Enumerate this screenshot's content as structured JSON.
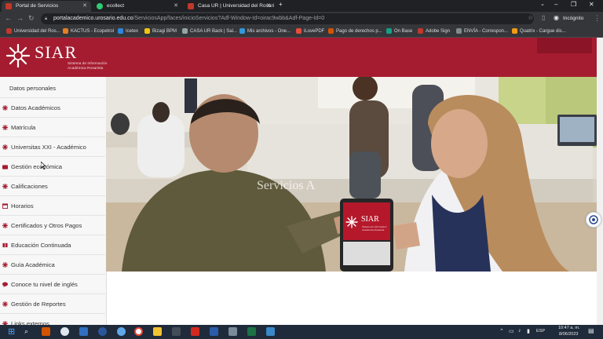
{
  "browser": {
    "tabs": [
      {
        "label": "Portal de Servicios",
        "active": true,
        "favicon_color": "#c0392b"
      },
      {
        "label": "ecollect",
        "active": false,
        "favicon_color": "#2ecc71"
      },
      {
        "label": "Casa UR | Universidad del Rosari",
        "active": false,
        "favicon_color": "#c0392b"
      }
    ],
    "new_tab": "+",
    "url_host": "portalacademico.urosario.edu.co",
    "url_path": "/ServiciosApp/faces/inicioServicios?Adf-Window-Id=oirac9wbb&Adf-Page-Id=0",
    "profile_label": "Incógnito",
    "bookmarks": [
      "Universidad del Ros...",
      "KACTUS - Ecopetrol",
      "Icetex",
      "Bizagi BPM",
      "CASA UR Back | Sal...",
      "Mis archivos - One...",
      "iLovePDF",
      "Pago de derechos p...",
      "On Base",
      "Adobe Sign",
      "ENVÍA - Correspon...",
      "Quatrix - Cargue dis..."
    ]
  },
  "header": {
    "brand": "SIAR",
    "subtitle_line1": "Sistema de Información",
    "subtitle_line2": "Académica Rosarista"
  },
  "sidebar": {
    "items": [
      {
        "label": "Datos personales",
        "icon": "none"
      },
      {
        "label": "Datos Académicos",
        "icon": "rosette-icon"
      },
      {
        "label": "Matrícula",
        "icon": "rosette-icon"
      },
      {
        "label": "Universitas XXI - Académico",
        "icon": "rosette-icon"
      },
      {
        "label": "Gestión económica",
        "icon": "wallet-icon"
      },
      {
        "label": "Calificaciones",
        "icon": "rosette-icon"
      },
      {
        "label": "Horarios",
        "icon": "calendar-icon"
      },
      {
        "label": "Certificados y Otros Pagos",
        "icon": "rosette-icon"
      },
      {
        "label": "Educación Continuada",
        "icon": "book-icon"
      },
      {
        "label": "Guía Académica",
        "icon": "rosette-icon"
      },
      {
        "label": "Conoce tu nivel de inglés",
        "icon": "chat-icon"
      },
      {
        "label": "Gestión de Reportes",
        "icon": "rosette-icon"
      },
      {
        "label": "Links externos",
        "icon": "rosette-icon"
      }
    ]
  },
  "hero": {
    "wall_text": "Servicios A",
    "tablet_brand": "SIAR",
    "tablet_sub1": "Sistema de Información",
    "tablet_sub2": "Académica Rosarista"
  },
  "taskbar": {
    "time": "10:47 a. m.",
    "date": "8/06/2023",
    "language": "ESP"
  },
  "colors": {
    "brand_red": "#a51c30",
    "browser_dark": "#202124",
    "taskbar": "#1f2b3a"
  }
}
